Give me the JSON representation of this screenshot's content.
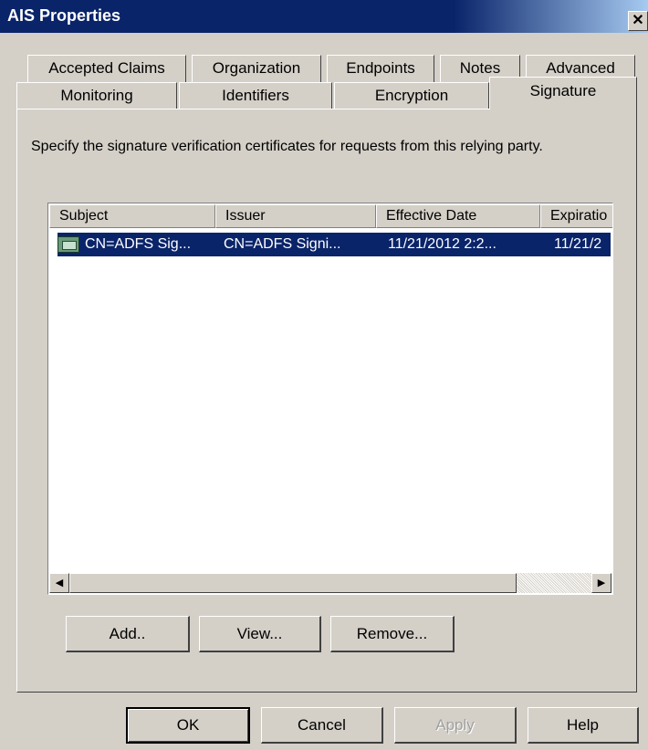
{
  "window": {
    "title": "AIS Properties"
  },
  "tabs": {
    "row_back": [
      "Accepted Claims",
      "Organization",
      "Endpoints",
      "Notes",
      "Advanced"
    ],
    "row_front": [
      "Monitoring",
      "Identifiers",
      "Encryption",
      "Signature"
    ],
    "active": "Signature"
  },
  "signature": {
    "description": "Specify the signature verification certificates for requests from this relying party.",
    "columns": [
      "Subject",
      "Issuer",
      "Effective Date",
      "Expiratio"
    ],
    "rows": [
      {
        "subject": "CN=ADFS Sig...",
        "issuer": "CN=ADFS Signi...",
        "effective": "11/21/2012 2:2...",
        "expiration": "11/21/2",
        "selected": true,
        "icon": "certificate-icon"
      }
    ],
    "buttons": {
      "add": "Add..",
      "view": "View...",
      "remove": "Remove..."
    }
  },
  "footer": {
    "ok": "OK",
    "cancel": "Cancel",
    "apply": "Apply",
    "help": "Help"
  }
}
